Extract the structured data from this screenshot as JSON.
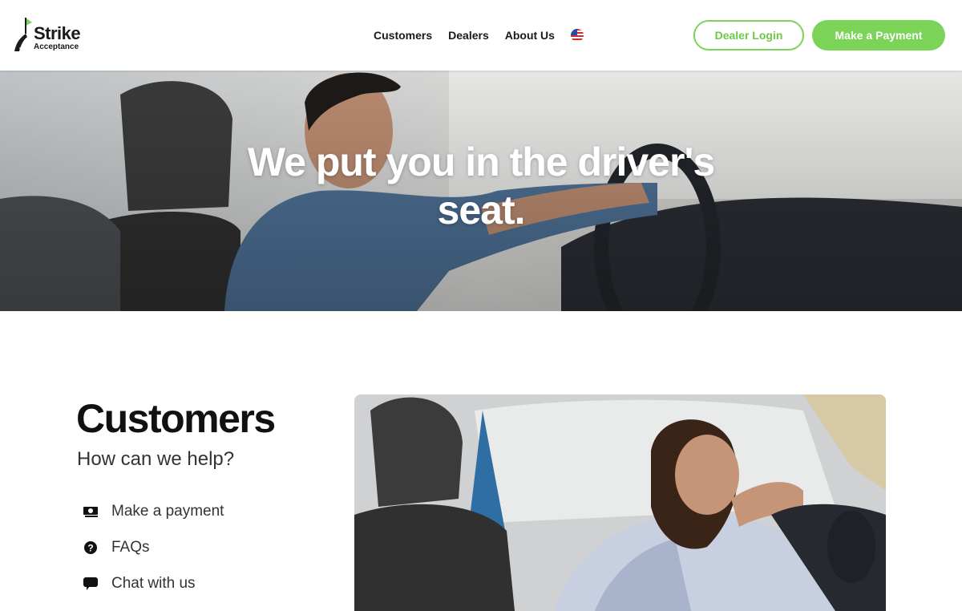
{
  "header": {
    "logo": {
      "line1": "Strike",
      "line2": "Acceptance"
    },
    "nav": [
      {
        "label": "Customers"
      },
      {
        "label": "Dealers"
      },
      {
        "label": "About Us"
      }
    ],
    "language_icon": "us-flag-icon",
    "dealer_login_label": "Dealer Login",
    "make_payment_label": "Make a Payment"
  },
  "hero": {
    "title": "We put you in the driver's seat."
  },
  "customers": {
    "title": "Customers",
    "subtitle": "How can we help?",
    "items": [
      {
        "label": "Make a payment",
        "icon": "money-icon"
      },
      {
        "label": "FAQs",
        "icon": "question-circle-icon"
      },
      {
        "label": "Chat with us",
        "icon": "chat-bubble-icon"
      }
    ]
  },
  "colors": {
    "accent": "#7bd357",
    "text_dark": "#111111"
  }
}
